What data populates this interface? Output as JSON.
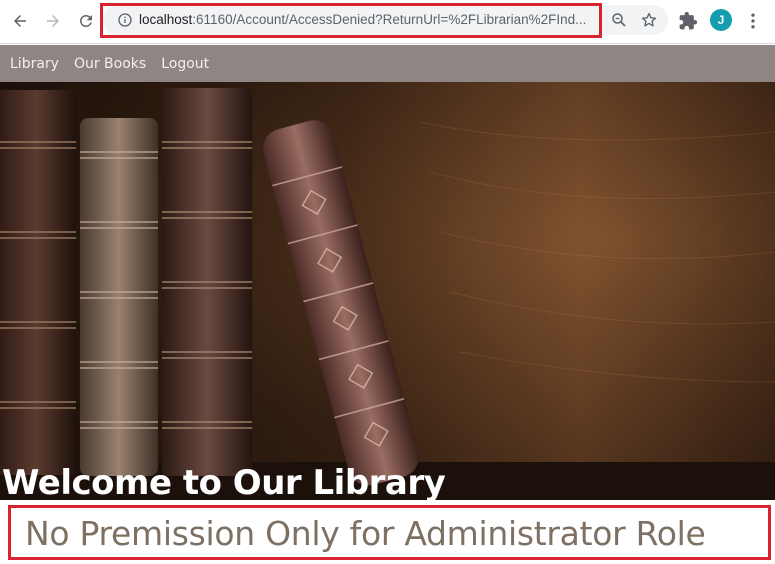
{
  "browser": {
    "url_host": "localhost",
    "url_rest": ":61160/Account/AccessDenied?ReturnUrl=%2FLibrarian%2FInd...",
    "avatar_letter": "J",
    "accent_color": "#129eaf",
    "icons": [
      "back-arrow-icon",
      "forward-arrow-icon",
      "reload-icon",
      "info-icon",
      "zoom-icon",
      "star-icon",
      "extensions-icon",
      "menu-dots-icon"
    ]
  },
  "nav": {
    "items": [
      {
        "label": "Library"
      },
      {
        "label": "Our Books"
      },
      {
        "label": "Logout"
      }
    ]
  },
  "hero": {
    "title": "Welcome to Our Library"
  },
  "message": {
    "text": "No Premission Only for Administrator Role"
  },
  "colors": {
    "highlight": "#d9232e",
    "navbar": "#8f8583",
    "message_text": "#7e7063"
  }
}
